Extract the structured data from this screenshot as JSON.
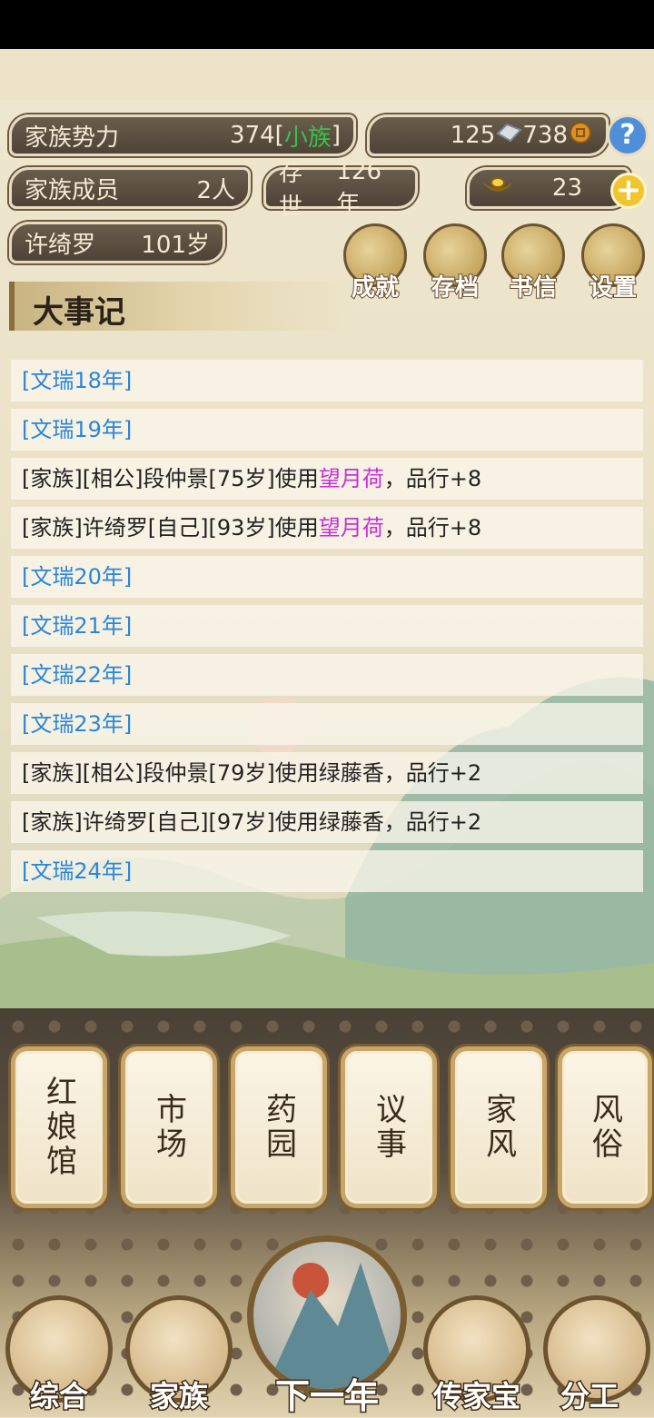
{
  "stats": {
    "power_label": "家族势力",
    "power_value": "374",
    "power_open": "[",
    "power_rank": "小族",
    "power_close": "]",
    "silver": "125",
    "copper": "738",
    "members_label": "家族成员",
    "members_value": "2人",
    "existence_label": "存世",
    "existence_value": "126年",
    "gold": "23",
    "person_name": "许绮罗",
    "person_age": "101岁"
  },
  "top_buttons": [
    "成就",
    "存档",
    "书信",
    "设置"
  ],
  "chronicle": {
    "title": "大事记",
    "entries": [
      {
        "type": "year",
        "text": "[文瑞18年]"
      },
      {
        "type": "year",
        "text": "[文瑞19年]"
      },
      {
        "type": "event",
        "pre": "[家族][相公]段仲景[75岁]使用",
        "item": "望月荷",
        "post": "，品行+8"
      },
      {
        "type": "event",
        "pre": "[家族]许绮罗[自己][93岁]使用",
        "item": "望月荷",
        "post": "，品行+8"
      },
      {
        "type": "year",
        "text": "[文瑞20年]"
      },
      {
        "type": "year",
        "text": "[文瑞21年]"
      },
      {
        "type": "year",
        "text": "[文瑞22年]"
      },
      {
        "type": "year",
        "text": "[文瑞23年]"
      },
      {
        "type": "event",
        "pre": "[家族][相公]段仲景[79岁]使用绿藤香，品行+2",
        "item": "",
        "post": ""
      },
      {
        "type": "event",
        "pre": "[家族]许绮罗[自己][97岁]使用绿藤香，品行+2",
        "item": "",
        "post": ""
      },
      {
        "type": "year",
        "text": "[文瑞24年]"
      }
    ]
  },
  "cards": [
    "红娘馆",
    "市场",
    "药园",
    "议事",
    "家风",
    "风俗"
  ],
  "bottom_nav": [
    "综合",
    "家族",
    "下一年",
    "传家宝",
    "分工"
  ],
  "colors": {
    "year": "#2b86d6",
    "item": "#c431d6",
    "rank": "#39c24b"
  }
}
